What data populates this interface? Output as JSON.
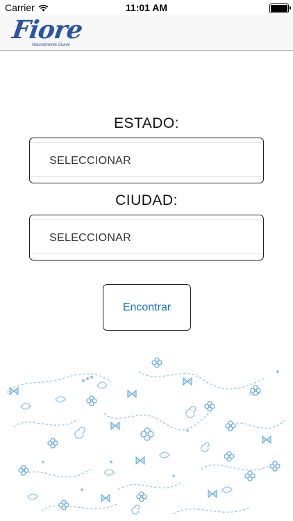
{
  "status_bar": {
    "carrier": "Carrier",
    "time": "11:01 AM",
    "wifi_icon": "wifi-icon",
    "battery_icon": "battery-icon"
  },
  "nav": {
    "logo_text": "Fiore",
    "logo_tagline": "Naturalmente Suave",
    "brand_color": "#2b54a6"
  },
  "form": {
    "estado_label": "ESTADO:",
    "estado_value": "SELECCIONAR",
    "ciudad_label": "CIUDAD:",
    "ciudad_value": "SELECCIONAR",
    "submit_label": "Encontrar",
    "accent_color": "#1a73d8"
  },
  "decoration": {
    "pattern_icon": "floral-pattern",
    "pattern_color": "#8fc3e6"
  }
}
